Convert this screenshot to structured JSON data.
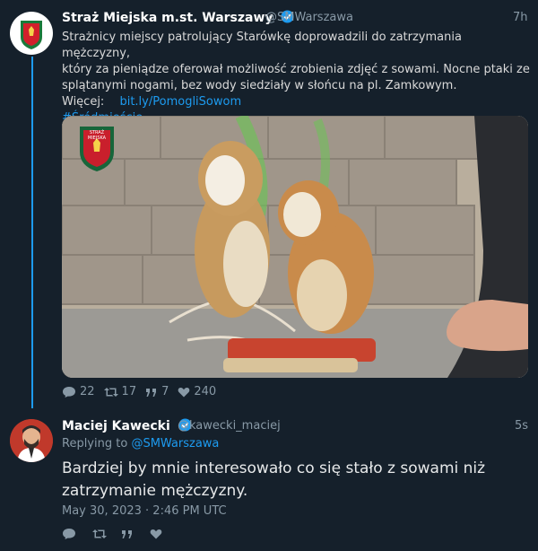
{
  "tweet": {
    "author_name": "Straż Miejska m.st. Warszawy",
    "handle": "@SMWarszawa",
    "time": "7h",
    "lines": [
      "Strażnicy miejscy patrolujący Starówkę doprowadzili do zatrzymania mężczyzny,",
      "który za pieniądze oferował możliwość zrobienia zdjęć z sowami. Nocne ptaki ze",
      "splątanymi nogami, bez wody siedziały w słońcu na pl. Zamkowym."
    ],
    "more_label": "Więcej:",
    "more_link": "bit.ly/PomogliSowom",
    "hashtag": "#Śródmieście",
    "logo_text": "STRAŻ MIEJSKA",
    "replies": "22",
    "retweets": "17",
    "quotes": "7",
    "likes": "240"
  },
  "reply": {
    "author_name": "Maciej Kawecki",
    "handle": "@kawecki_maciej",
    "time": "5s",
    "replying_label": "Replying to",
    "replying_to": "@SMWarszawa",
    "text_lines": [
      "Bardziej by mnie interesowało co się stało z sowami niż",
      "zatrzymanie mężczyzny."
    ],
    "timestamp": "May 30, 2023 · 2:46 PM UTC"
  },
  "colors": {
    "background": "#15202b",
    "accent": "#1d9bf0",
    "muted": "#8899a6",
    "text": "#d9d9d9"
  }
}
